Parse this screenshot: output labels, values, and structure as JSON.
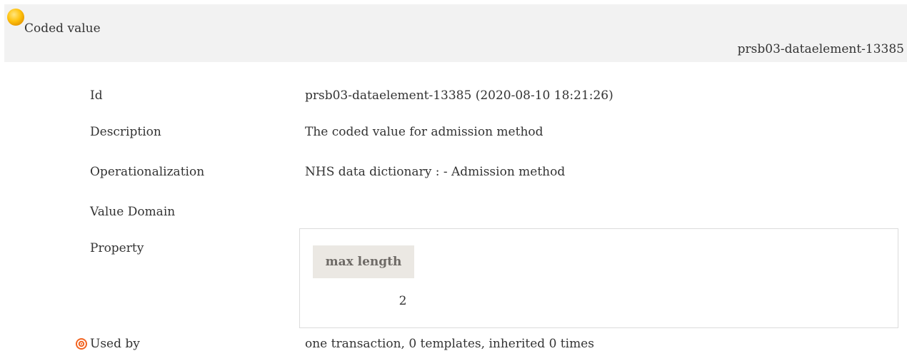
{
  "header": {
    "title": "Coded value",
    "identifier": "prsb03-dataelement-13385",
    "status_icon": "yellow-circle-icon",
    "status_color": "#ffc20e"
  },
  "details": {
    "id_label": "Id",
    "id_value": "prsb03-dataelement-13385 (2020-08-10 18:21:26)",
    "description_label": "Description",
    "description_value": "The coded value for admission method",
    "operationalization_label": "Operationalization",
    "operationalization_value": "NHS data dictionary : - Admission method",
    "value_domain_label": "Value Domain",
    "property_label": "Property",
    "property_table": {
      "column_header": "max length",
      "value": "2"
    },
    "used_by_icon": "target-icon",
    "used_by_label": "Used by",
    "used_by_value": "one transaction, 0 templates, inherited 0 times"
  },
  "colors": {
    "header_background": "#f2f2f2",
    "property_header_background": "#ebe8e3",
    "used_by_icon_color": "#f26522"
  }
}
